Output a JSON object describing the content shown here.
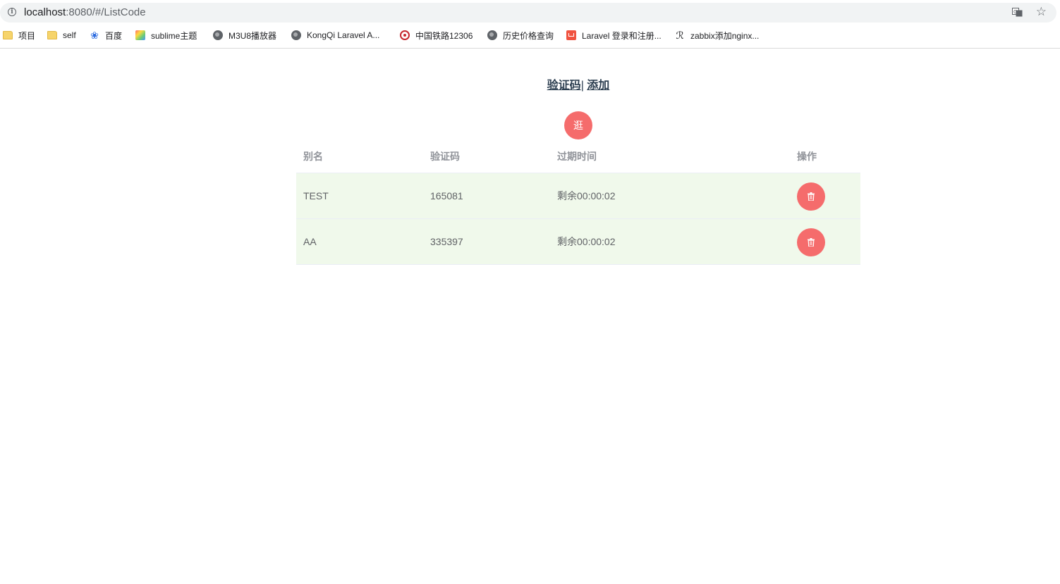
{
  "browser": {
    "url_host": "localhost",
    "url_rest": ":8080/#/ListCode",
    "bookmarks": [
      {
        "label": "项目",
        "icon": "folder-icon"
      },
      {
        "label": "self",
        "icon": "folder-icon"
      },
      {
        "label": "百度",
        "icon": "baidu-paw-icon"
      },
      {
        "label": "sublime主题",
        "icon": "sublime-icon"
      },
      {
        "label": "M3U8播放器",
        "icon": "globe-icon"
      },
      {
        "label": "KongQi Laravel A...",
        "icon": "globe-icon"
      },
      {
        "label": "中国铁路12306",
        "icon": "railway-icon"
      },
      {
        "label": "历史价格查询",
        "icon": "globe-icon"
      },
      {
        "label": "Laravel 登录和注册...",
        "icon": "laravel-icon"
      },
      {
        "label": "zabbix添加nginx...",
        "icon": "zabbix-icon"
      }
    ]
  },
  "nav": {
    "link1": "验证码",
    "separator": "|",
    "link2": "添加"
  },
  "refresh_button": {
    "label": "逛"
  },
  "table": {
    "headers": [
      "别名",
      "验证码",
      "过期时间",
      "操作"
    ],
    "rows": [
      {
        "alias": "TEST",
        "code": "165081",
        "expire": "剩余00:00:02"
      },
      {
        "alias": "AA",
        "code": "335397",
        "expire": "剩余00:00:02"
      }
    ]
  },
  "colors": {
    "danger": "#f56c6c",
    "row_success": "#f0f9eb",
    "header_text": "#909399",
    "body_text": "#606266",
    "nav_text": "#2c3e50"
  }
}
